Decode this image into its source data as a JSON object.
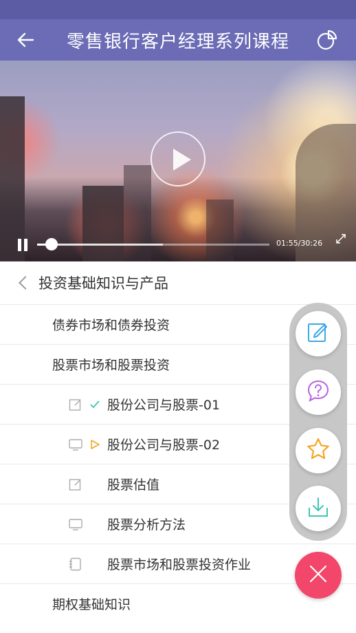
{
  "header": {
    "title": "零售银行客户经理系列课程",
    "back_icon": "arrow-left-icon",
    "right_icon": "pie-chart-icon"
  },
  "player": {
    "time": "01:55/30:26",
    "progress": 0.063,
    "buffered": 0.54
  },
  "section": {
    "title": "投资基础知识与产品"
  },
  "list": [
    {
      "type": "chapter",
      "label": "债券市场和债券投资"
    },
    {
      "type": "chapter",
      "label": "股票市场和股票投资"
    },
    {
      "type": "lesson",
      "icon": "edit-icon",
      "status": "check-icon",
      "label": "股份公司与股票-01"
    },
    {
      "type": "lesson",
      "icon": "monitor-icon",
      "status": "play-icon",
      "label": "股份公司与股票-02"
    },
    {
      "type": "lesson",
      "icon": "edit-icon",
      "status": "",
      "label": "股票估值"
    },
    {
      "type": "lesson",
      "icon": "monitor-icon",
      "status": "",
      "label": "股票分析方法"
    },
    {
      "type": "lesson",
      "icon": "notebook-icon",
      "status": "",
      "label": "股票市场和股票投资作业"
    },
    {
      "type": "chapter",
      "label": "期权基础知识"
    }
  ],
  "colors": {
    "header": "#6b6cb5",
    "status_bar": "#5b5ca3",
    "accent_teal": "#3ec5b4",
    "accent_orange": "#f5a623",
    "accent_purple": "#b561e0",
    "accent_pink": "#f2476a",
    "note_blue": "#3aa9e6"
  },
  "fabs": [
    {
      "name": "note-icon"
    },
    {
      "name": "question-icon"
    },
    {
      "name": "star-icon"
    },
    {
      "name": "download-icon"
    },
    {
      "name": "close-icon"
    }
  ]
}
